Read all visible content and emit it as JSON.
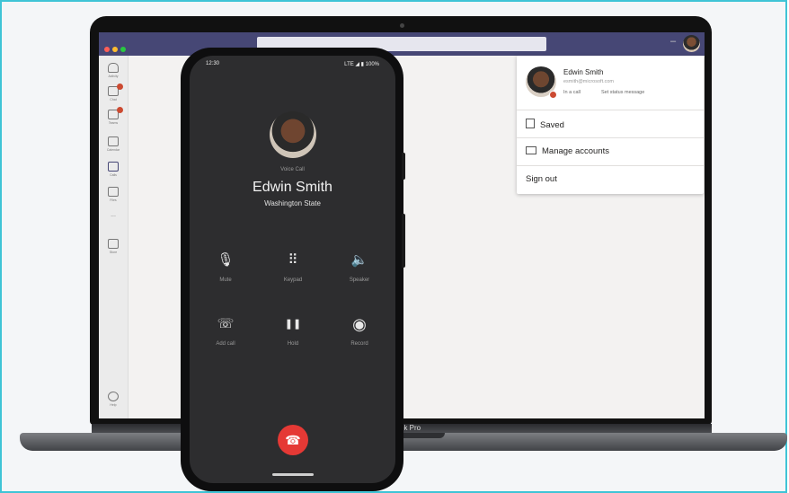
{
  "colors": {
    "frame": "#3fc4d6",
    "teams_titlebar": "#464775",
    "end_call": "#e53935",
    "status_busy": "#cc4a31"
  },
  "laptop": {
    "brand_text": "ok Pro"
  },
  "teams": {
    "rail": [
      {
        "label": "Activity",
        "icon": "bell-icon",
        "badge": false
      },
      {
        "label": "Chat",
        "icon": "chat-icon",
        "badge": true
      },
      {
        "label": "Teams",
        "icon": "teams-icon",
        "badge": true
      },
      {
        "label": "Calendar",
        "icon": "calendar-icon",
        "badge": false
      },
      {
        "label": "Calls",
        "icon": "phone-icon",
        "badge": false
      },
      {
        "label": "Files",
        "icon": "file-icon",
        "badge": false
      },
      {
        "label": "...",
        "icon": "more-icon",
        "badge": false
      },
      {
        "label": "Store",
        "icon": "store-icon",
        "badge": false
      },
      {
        "label": "Help",
        "icon": "help-icon",
        "badge": false
      }
    ],
    "profile_menu": {
      "name": "Edwin Smith",
      "email": "esmith@microsoft.com",
      "status": "In a call",
      "set_status": "Set status message",
      "items": [
        {
          "label": "Saved",
          "icon": "bookmark-icon"
        },
        {
          "label": "Manage accounts",
          "icon": "accounts-icon"
        },
        {
          "label": "Sign out",
          "icon": ""
        }
      ]
    }
  },
  "phone": {
    "time": "12:30",
    "status_bar": "LTE ◢ ▮ 100%",
    "call_type": "Voice Call",
    "caller_name": "Edwin Smith",
    "caller_location": "Washington State",
    "controls": [
      {
        "label": "Mute",
        "icon": "mute-icon",
        "glyph": "🎙"
      },
      {
        "label": "Keypad",
        "icon": "keypad-icon",
        "glyph": "⠿"
      },
      {
        "label": "Speaker",
        "icon": "speaker-icon",
        "glyph": "🔈"
      },
      {
        "label": "Add call",
        "icon": "add-call-icon",
        "glyph": "☏"
      },
      {
        "label": "Hold",
        "icon": "hold-icon",
        "glyph": "❚❚"
      },
      {
        "label": "Record",
        "icon": "record-icon",
        "glyph": "◉"
      }
    ],
    "end_call_glyph": "☎"
  }
}
